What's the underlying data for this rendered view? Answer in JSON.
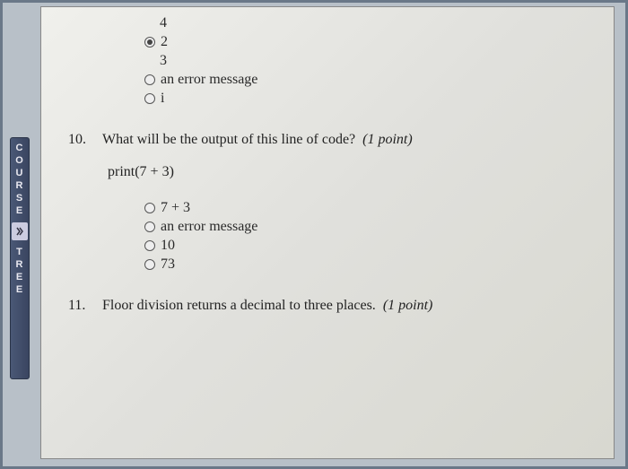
{
  "sidebar": {
    "top_text": "COURSE",
    "bottom_text": "TREE"
  },
  "partial_question": {
    "pretext": "4",
    "options": [
      {
        "label": "2",
        "selected": true
      },
      {
        "label": "",
        "pretext": "3"
      },
      {
        "label": "an error message",
        "selected": false
      },
      {
        "label": "i",
        "selected": false
      }
    ]
  },
  "q10": {
    "number": "10.",
    "text": "What will be the output of this line of code?",
    "points": "(1 point)",
    "code": "print(7 + 3)",
    "options": [
      {
        "label": "7 + 3"
      },
      {
        "label": "an error message"
      },
      {
        "label": "10"
      },
      {
        "label": "73"
      }
    ]
  },
  "q11": {
    "number": "11.",
    "text": "Floor division returns a decimal to three places.",
    "points": "(1 point)"
  }
}
